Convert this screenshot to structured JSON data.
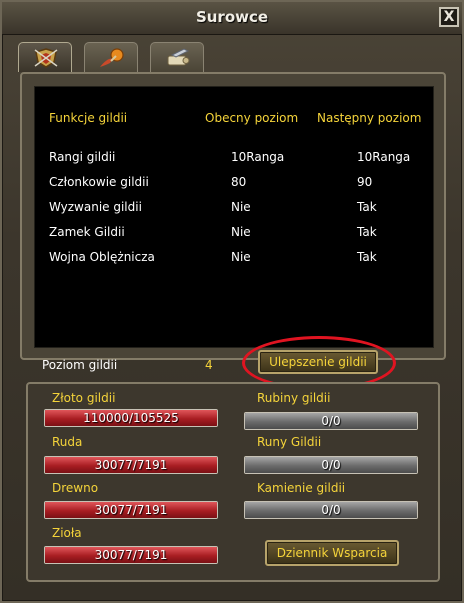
{
  "window": {
    "title": "Surowce",
    "close_glyph": "X"
  },
  "tabs": [
    {
      "icon": "shield-icon",
      "active": true
    },
    {
      "icon": "potion-icon",
      "active": false
    },
    {
      "icon": "scroll-icon",
      "active": false
    }
  ],
  "table": {
    "headers": [
      "Funkcje gildii",
      "Obecny poziom",
      "Następny poziom"
    ],
    "rows": [
      {
        "name": "Rangi gildii",
        "current": "10Ranga",
        "next": "10Ranga"
      },
      {
        "name": "Członkowie gildii",
        "current": "80",
        "next": "90"
      },
      {
        "name": "Wyzwanie gildii",
        "current": "Nie",
        "next": "Tak"
      },
      {
        "name": "Zamek Gildii",
        "current": "Nie",
        "next": "Tak"
      },
      {
        "name": "Wojna Oblężnicza",
        "current": "Nie",
        "next": "Tak"
      }
    ]
  },
  "level": {
    "label": "Poziom gildii",
    "value": "4",
    "upgrade_button": "Ulepszenie gildii"
  },
  "resources": {
    "gold": {
      "label": "Złoto gildii",
      "value": "110000/105525",
      "fill": 1.0
    },
    "ore": {
      "label": "Ruda",
      "value": "30077/7191",
      "fill": 1.0
    },
    "wood": {
      "label": "Drewno",
      "value": "30077/7191",
      "fill": 1.0
    },
    "herbs": {
      "label": "Zioła",
      "value": "30077/7191",
      "fill": 1.0
    },
    "rubies": {
      "label": "Rubiny gildii",
      "value": "0/0",
      "fill": 1.0
    },
    "runes": {
      "label": "Runy Gildii",
      "value": "0/0",
      "fill": 1.0
    },
    "stones": {
      "label": "Kamienie gildii",
      "value": "0/0",
      "fill": 1.0
    }
  },
  "support_button": "Dziennik Wsparcia",
  "colors": {
    "accent_yellow": "#f5d43a",
    "bar_red": "#a81d22",
    "bar_grey": "#6b6b6b",
    "highlight_ring": "#e01421"
  }
}
